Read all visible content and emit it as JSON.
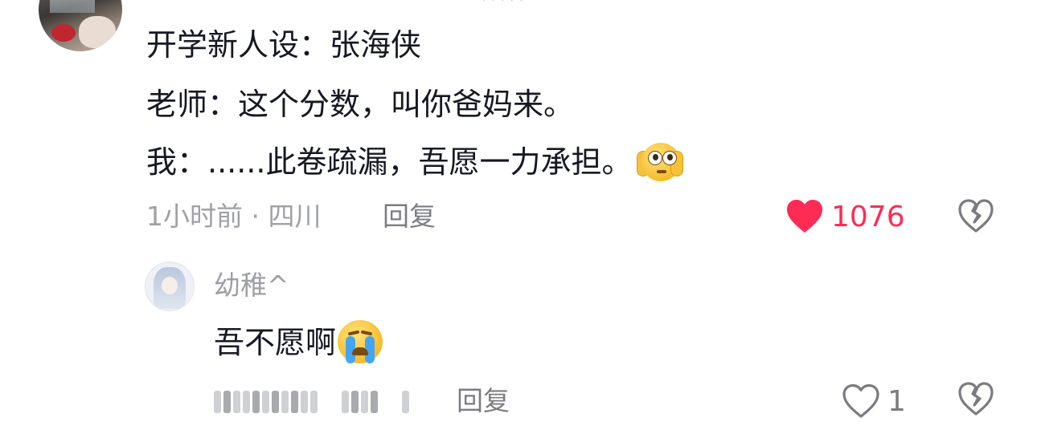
{
  "comment": {
    "lines": [
      "开学新人设：张海侠",
      "老师：这个分数，叫你爸妈来。",
      "我：......此卷疏漏，吾愿一力承担。"
    ],
    "time_location": "1小时前 · 四川",
    "reply_label": "回复",
    "like_count": "1076",
    "liked": true,
    "emoji": "flushed-face-with-hands-emoji"
  },
  "reply": {
    "username": "幼稚^",
    "text": "吾不愿啊",
    "emoji": "loudly-crying-face-emoji",
    "reply_label": "回复",
    "like_count": "1",
    "liked": false
  },
  "colors": {
    "like_red": "#fe2c55",
    "primary_text": "#161823",
    "secondary_text": "#a0a1a6",
    "action_text": "#7b7c82"
  }
}
